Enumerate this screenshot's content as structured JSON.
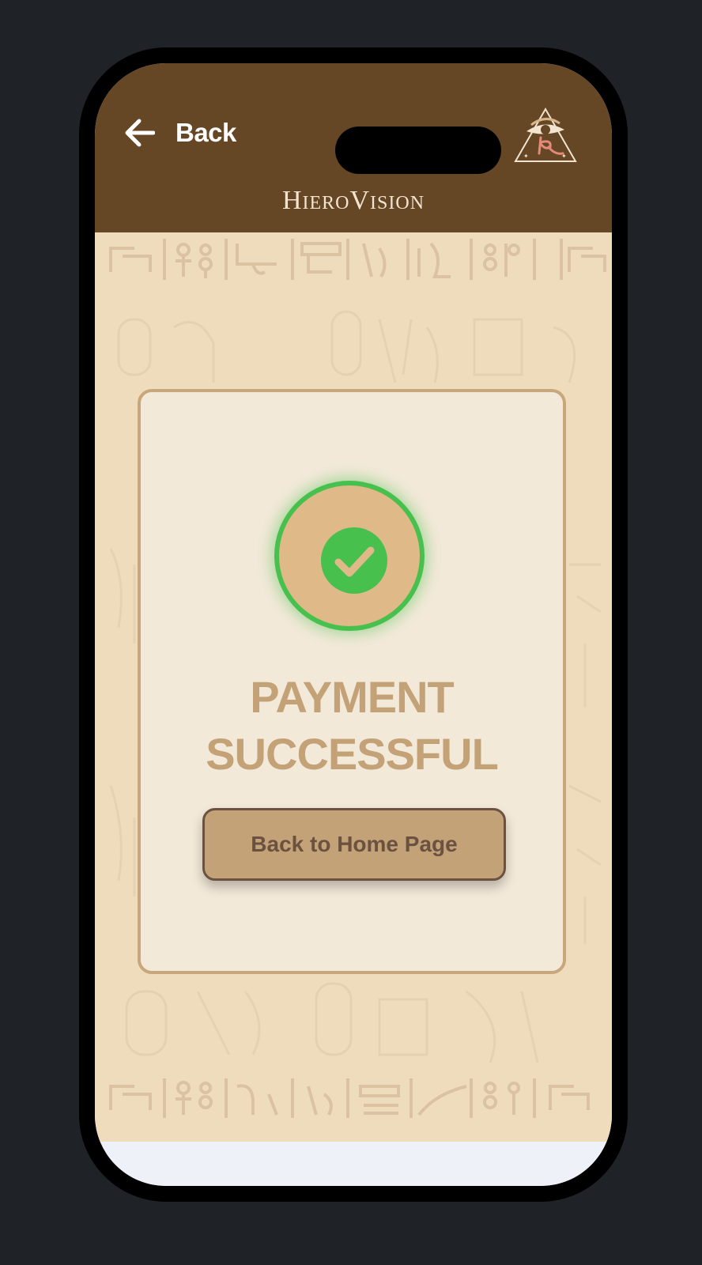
{
  "header": {
    "back_label": "Back",
    "brand_name": "HieroVision",
    "back_icon": "arrow-left-icon",
    "logo_icon": "eye-of-horus-pyramid-icon"
  },
  "card": {
    "status_icon": "checkmark-circle-icon",
    "title_line1": "PAYMENT",
    "title_line2": "SUCCESSFUL",
    "button_label": "Back to Home Page"
  },
  "colors": {
    "header_bg": "#654625",
    "papyrus_bg": "#efdcbd",
    "card_bg": "#f3e9d9",
    "accent_tan": "#c4a278",
    "success_green": "#47c04e",
    "button_text": "#6b5240"
  }
}
